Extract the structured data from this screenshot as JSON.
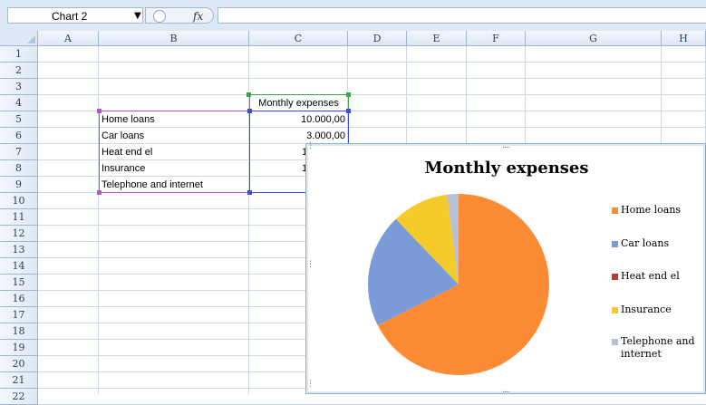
{
  "formula_bar": {
    "name_box": "Chart 2",
    "fx_label": "fx",
    "formula": ""
  },
  "columns": [
    "A",
    "B",
    "C",
    "D",
    "E",
    "F",
    "G",
    "H"
  ],
  "rows": [
    "1",
    "2",
    "3",
    "4",
    "5",
    "6",
    "7",
    "8",
    "9",
    "10",
    "11",
    "12",
    "13",
    "14",
    "15",
    "16",
    "17",
    "18",
    "19",
    "20",
    "21",
    "22"
  ],
  "sheet": {
    "header_c4": "Monthly expenses",
    "labels": [
      "Home loans",
      "Car loans",
      "Heat end el",
      "Insurance",
      "Telephone and internet"
    ],
    "values": [
      "10.000,00",
      "3.000,00",
      "1",
      "1",
      ""
    ]
  },
  "chart": {
    "title": "Monthly expenses",
    "legend": [
      {
        "label": "Home loans",
        "color": "#fc8b36"
      },
      {
        "label": "Car loans",
        "color": "#7a9bd8"
      },
      {
        "label": "Heat end el",
        "color": "#c0392b"
      },
      {
        "label": "Insurance",
        "color": "#f5cb2c"
      },
      {
        "label": "Telephone and internet",
        "color": "#b7c0d6"
      }
    ]
  },
  "chart_data": {
    "type": "pie",
    "title": "Monthly expenses",
    "categories": [
      "Home loans",
      "Car loans",
      "Heat end el",
      "Insurance",
      "Telephone and internet"
    ],
    "values": [
      10000,
      3000,
      0,
      1500,
      300
    ],
    "colors": [
      "#fc8b36",
      "#7a9bd8",
      "#c0392b",
      "#f5cb2c",
      "#b7c0d6"
    ]
  }
}
